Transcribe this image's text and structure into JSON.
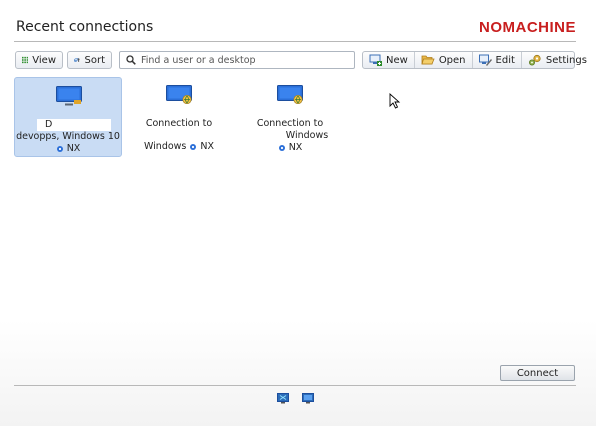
{
  "header": {
    "title": "Recent connections",
    "brand": "NOMACHINE"
  },
  "toolbar": {
    "view_label": "View",
    "sort_label": "Sort",
    "search_placeholder": "Find a user or a desktop",
    "new_label": "New",
    "open_label": "Open",
    "edit_label": "Edit",
    "settings_label": "Settings"
  },
  "connections": [
    {
      "line1": "D",
      "line2": "devopps, Windows 10",
      "protocol": "NX"
    },
    {
      "line1": "Connection to",
      "line2": "Windows",
      "protocol": "NX"
    },
    {
      "line1": "Connection to",
      "line2": "Windows",
      "protocol": "NX"
    }
  ],
  "footer": {
    "connect_label": "Connect"
  },
  "colors": {
    "brand": "#c81e1e",
    "selection": "#c9dcf4",
    "accent": "#2b6fd8"
  }
}
